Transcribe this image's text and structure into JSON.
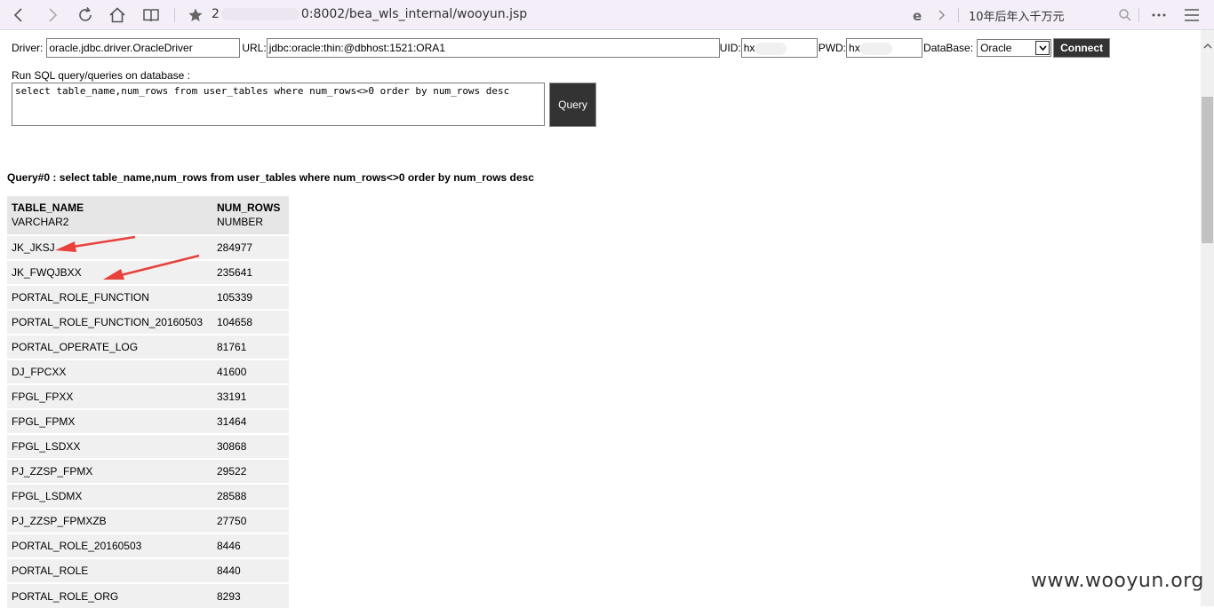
{
  "browser": {
    "address_prefix": "2",
    "address_suffix": "0:8002/bea_wls_internal/wooyun.jsp",
    "search_text": "10年后年入千万元"
  },
  "connection": {
    "driver_label": "Driver:",
    "driver_value": "oracle.jdbc.driver.OracleDriver",
    "url_label": "URL:",
    "url_value": "jdbc:oracle:thin:@dbhost:1521:ORA1",
    "uid_label": "UID:",
    "uid_value": "hx",
    "pwd_label": "PWD:",
    "pwd_value": "hx",
    "database_label": "DataBase:",
    "database_value": "Oracle",
    "connect_label": "Connect"
  },
  "query": {
    "run_label": "Run SQL query/queries on database :",
    "sql_text": "select table_name,num_rows from user_tables where num_rows<>0 order by num_rows desc",
    "query_button": "Query",
    "result_title": "Query#0 : select table_name,num_rows from user_tables where num_rows<>0 order by num_rows desc"
  },
  "results": {
    "columns": [
      {
        "name": "TABLE_NAME",
        "type": "VARCHAR2"
      },
      {
        "name": "NUM_ROWS",
        "type": "NUMBER"
      }
    ],
    "rows": [
      [
        "JK_JKSJ",
        "284977"
      ],
      [
        "JK_FWQJBXX",
        "235641"
      ],
      [
        "PORTAL_ROLE_FUNCTION",
        "105339"
      ],
      [
        "PORTAL_ROLE_FUNCTION_20160503",
        "104658"
      ],
      [
        "PORTAL_OPERATE_LOG",
        "81761"
      ],
      [
        "DJ_FPCXX",
        "41600"
      ],
      [
        "FPGL_FPXX",
        "33191"
      ],
      [
        "FPGL_FPMX",
        "31464"
      ],
      [
        "FPGL_LSDXX",
        "30868"
      ],
      [
        "PJ_ZZSP_FPMX",
        "29522"
      ],
      [
        "FPGL_LSDMX",
        "28588"
      ],
      [
        "PJ_ZZSP_FPMXZB",
        "27750"
      ],
      [
        "PORTAL_ROLE_20160503",
        "8446"
      ],
      [
        "PORTAL_ROLE",
        "8440"
      ],
      [
        "PORTAL_ROLE_ORG",
        "8293"
      ]
    ]
  },
  "watermark": "www.wooyun.org",
  "colors": {
    "toolbar_bg": "#f3eef7",
    "button_bg": "#333333",
    "header_bg": "#e6e6e6",
    "row_bg": "#f0f0f0",
    "arrow": "#e8413c"
  }
}
